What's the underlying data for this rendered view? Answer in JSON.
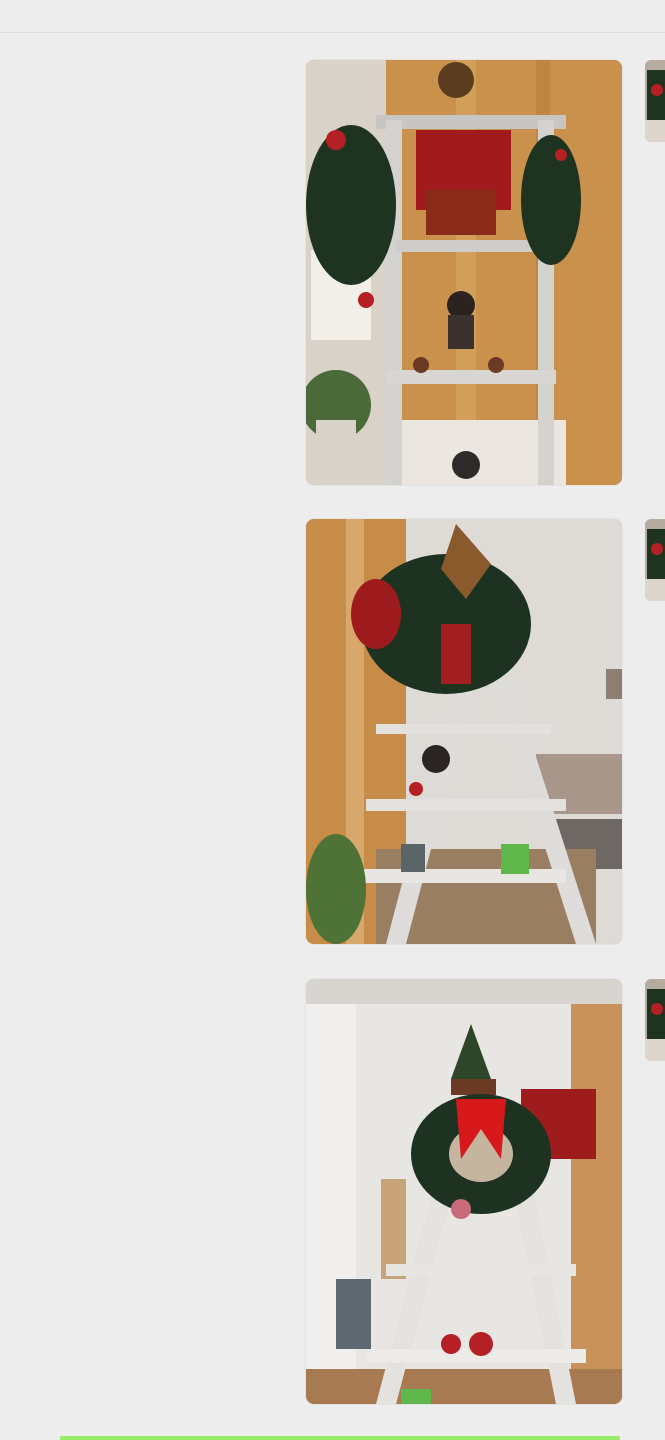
{
  "header": {
    "title": "",
    "partial_title_glyphs": "• • • •"
  },
  "messages": [
    {
      "type": "image",
      "sender": "self",
      "description_key": "ladder-photo-1"
    },
    {
      "type": "image",
      "sender": "self",
      "description_key": "ladder-photo-2"
    },
    {
      "type": "image",
      "sender": "self",
      "description_key": "ladder-photo-3"
    }
  ],
  "colors": {
    "background": "#ededed",
    "self_bubble": "#95ec69",
    "divider": "#dcdcdc"
  }
}
